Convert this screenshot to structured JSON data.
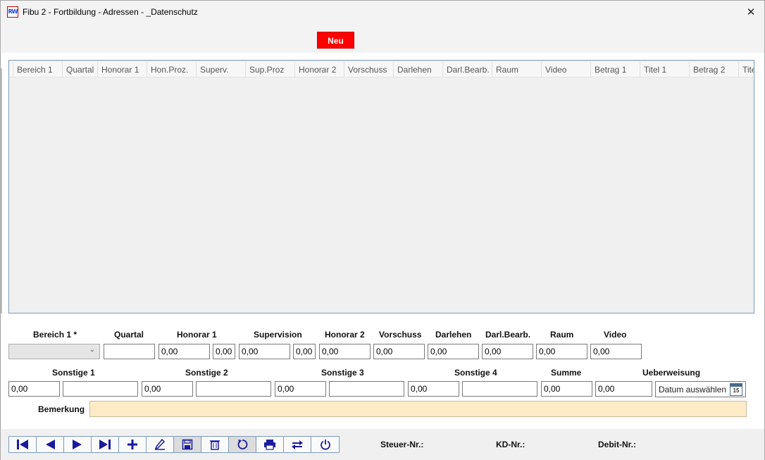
{
  "window": {
    "title": "Fibu 2 - Fortbildung - Adressen - _Datenschutz",
    "icon_text": "RW",
    "close_glyph": "✕"
  },
  "topbar": {
    "neu_label": "Neu"
  },
  "grid": {
    "columns": [
      "Bereich 1",
      "Quartal",
      "Honorar 1",
      "Hon.Proz.",
      "Superv.",
      "Sup.Proz",
      "Honorar 2",
      "Vorschuss",
      "Darlehen",
      "Darl.Bearb.",
      "Raum",
      "Video",
      "Betrag 1",
      "Titel 1",
      "Betrag 2",
      "Titel"
    ]
  },
  "form": {
    "labels": {
      "bereich1": "Bereich 1 *",
      "quartal": "Quartal",
      "honorar1": "Honorar 1",
      "supervision": "Supervision",
      "honorar2": "Honorar 2",
      "vorschuss": "Vorschuss",
      "darlehen": "Darlehen",
      "darl_bearb": "Darl.Bearb.",
      "raum": "Raum",
      "video": "Video",
      "sonstige1": "Sonstige 1",
      "sonstige2": "Sonstige 2",
      "sonstige3": "Sonstige 3",
      "sonstige4": "Sonstige 4",
      "summe": "Summe",
      "ueberweisung": "Ueberweisung",
      "bemerkung": "Bemerkung"
    },
    "values": {
      "bereich1": "",
      "quartal": "",
      "honorar1": "0,00",
      "hon_proz": "0,00",
      "supervision": "0,00",
      "sup_proz": "0,00",
      "honorar2": "0,00",
      "vorschuss": "0,00",
      "darlehen": "0,00",
      "darl_bearb": "0,00",
      "raum": "0,00",
      "video": "0,00",
      "sonstige1_betrag": "0,00",
      "sonstige1_text": "",
      "sonstige2_betrag": "0,00",
      "sonstige2_text": "",
      "sonstige3_betrag": "0,00",
      "sonstige3_text": "",
      "sonstige4_betrag": "0,00",
      "sonstige4_text": "",
      "summe": "0,00",
      "ueberweisung_betrag": "0,00",
      "bemerkung": ""
    },
    "date_placeholder": "Datum auswählen",
    "calendar_day": "15"
  },
  "footer": {
    "steuer_nr_label": "Steuer-Nr.:",
    "kd_nr_label": "KD-Nr.:",
    "debit_nr_label": "Debit-Nr.:"
  },
  "toolbar_icons": [
    "first-record-icon",
    "previous-record-icon",
    "next-record-icon",
    "last-record-icon",
    "add-icon",
    "edit-icon",
    "save-icon",
    "delete-icon",
    "undo-icon",
    "print-icon",
    "transfer-icon",
    "power-icon"
  ],
  "colors": {
    "neu_button": "#ff0000",
    "bemerkung_field": "#fdebc8",
    "toolbar_icon": "#1a1a9c"
  }
}
